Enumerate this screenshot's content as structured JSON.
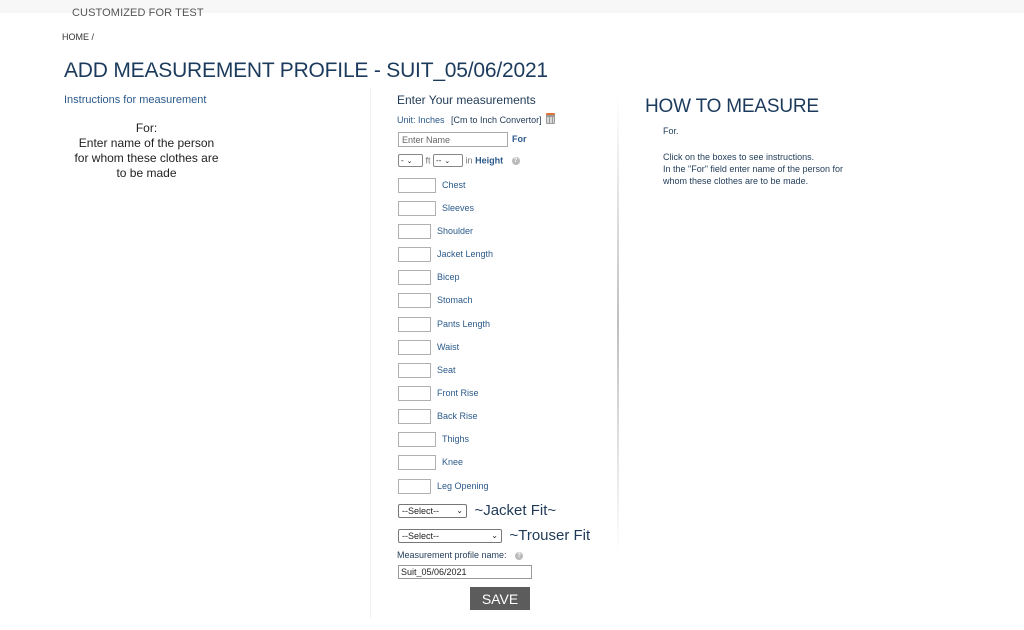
{
  "header": {
    "brand": "CUSTOMIZED FOR TEST",
    "breadcrumb": "HOME  /",
    "title": "ADD MEASUREMENT PROFILE - SUIT_05/06/2021"
  },
  "instructions": {
    "heading": "Instructions for measurement",
    "lines": [
      "For:",
      "Enter name of the person",
      "for whom these clothes are",
      "to be made"
    ]
  },
  "form": {
    "heading": "Enter Your measurements",
    "unit_label": "Unit: Inches",
    "converter_link": "[Cm to Inch Convertor]",
    "converter_icon": "calculator-icon",
    "name_placeholder": "Enter Name",
    "name_value": "",
    "for_label": "For",
    "height": {
      "ft_value": "-",
      "ft_unit": "ft",
      "in_value": "--",
      "in_unit": "in",
      "label": "Height",
      "help_icon": "question-circle-icon"
    },
    "measurements": [
      {
        "label": "Chest",
        "value": ""
      },
      {
        "label": "Sleeves",
        "value": ""
      },
      {
        "label": "Shoulder",
        "value": ""
      },
      {
        "label": "Jacket Length",
        "value": ""
      },
      {
        "label": "Bicep",
        "value": ""
      },
      {
        "label": "Stomach",
        "value": ""
      },
      {
        "label": "Pants Length",
        "value": ""
      },
      {
        "label": "Waist",
        "value": ""
      },
      {
        "label": "Seat",
        "value": ""
      },
      {
        "label": "Front Rise",
        "value": ""
      },
      {
        "label": "Back Rise",
        "value": ""
      },
      {
        "label": "Thighs",
        "value": ""
      },
      {
        "label": "Knee",
        "value": ""
      },
      {
        "label": "Leg Opening",
        "value": ""
      }
    ],
    "jacket_fit": {
      "selected": "--Select--",
      "label": "~Jacket Fit~"
    },
    "trouser_fit": {
      "selected": "--Select--",
      "label": "~Trouser Fit"
    },
    "profile_name_label": "Measurement profile name:",
    "profile_name_value": "Suit_05/06/2021",
    "save_label": "SAVE"
  },
  "how_to": {
    "title": "HOW TO MEASURE",
    "for_text": "For.",
    "lines": [
      "Click on the boxes to see instructions.",
      "In the \"For\" field enter name of the person for",
      "whom these clothes are to be made."
    ]
  }
}
